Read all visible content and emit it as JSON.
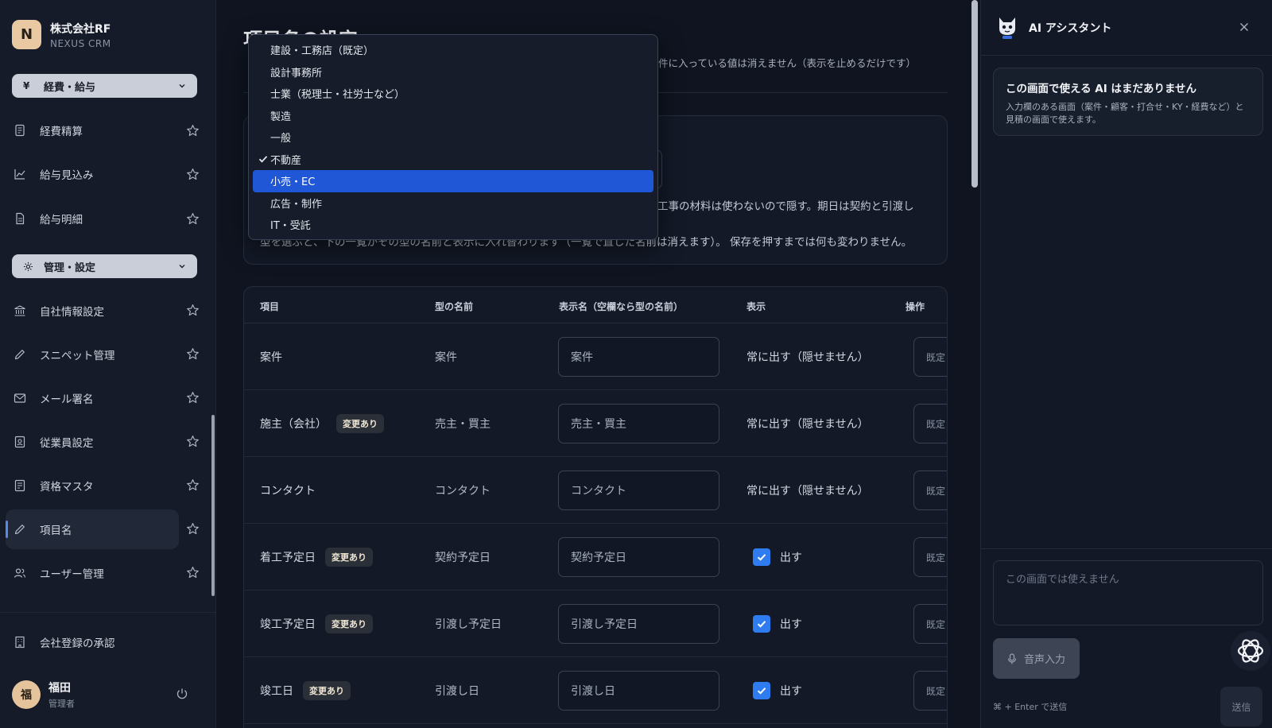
{
  "brand": {
    "logo_letter": "N",
    "name": "株式会社RF",
    "subtitle": "NEXUS CRM"
  },
  "sidebar": {
    "group_finance": {
      "icon": "yen-icon",
      "label": "経費・給与"
    },
    "finance_items": [
      {
        "icon": "receipt-icon",
        "label": "経費精算"
      },
      {
        "icon": "chart-line-icon",
        "label": "給与見込み"
      },
      {
        "icon": "document-icon",
        "label": "給与明細"
      }
    ],
    "group_admin": {
      "icon": "gear-icon",
      "label": "管理・設定"
    },
    "admin_items": [
      {
        "icon": "bank-icon",
        "label": "自社情報設定"
      },
      {
        "icon": "pencil-icon",
        "label": "スニペット管理"
      },
      {
        "icon": "mail-icon",
        "label": "メール署名"
      },
      {
        "icon": "id-badge-icon",
        "label": "従業員設定"
      },
      {
        "icon": "certificate-icon",
        "label": "資格マスタ"
      },
      {
        "icon": "pencil-icon",
        "label": "項目名",
        "active": true
      },
      {
        "icon": "users-icon",
        "label": "ユーザー管理"
      }
    ],
    "approval": {
      "icon": "building-icon",
      "label": "会社登録の承認"
    },
    "user": {
      "avatar": "福",
      "name": "福田",
      "role": "管理者"
    }
  },
  "main": {
    "title": "項目名の設定",
    "description_visible_end": "件に入っている値は消えません（表示を止めるだけです）",
    "card": {
      "text_line1_visible": "工事の材料は使わないので隠す。期日は契約と引渡し",
      "text_line2_visible": "型を選ぶと、下の一覧がその型の名前と表示に入れ替わります（一覧で直した名前は消えます）。 保存を押すまでは何も変わりません。"
    },
    "table": {
      "headers": [
        "項目",
        "型の名前",
        "表示名（空欄なら型の名前）",
        "表示",
        "操作"
      ],
      "rows": [
        {
          "item": "案件",
          "badge": "",
          "type_name": "案件",
          "display_name": "案件",
          "visibility": "常に出す（隠せません）",
          "checked": false,
          "op": "既定"
        },
        {
          "item": "施主（会社）",
          "badge": "変更あり",
          "type_name": "売主・買主",
          "display_name": "売主・買主",
          "visibility": "常に出す（隠せません）",
          "checked": false,
          "op": "既定"
        },
        {
          "item": "コンタクト",
          "badge": "",
          "type_name": "コンタクト",
          "display_name": "コンタクト",
          "visibility": "常に出す（隠せません）",
          "checked": false,
          "op": "既定"
        },
        {
          "item": "着工予定日",
          "badge": "変更あり",
          "type_name": "契約予定日",
          "display_name": "契約予定日",
          "visibility": "出す",
          "checked": true,
          "op": "既定"
        },
        {
          "item": "竣工予定日",
          "badge": "変更あり",
          "type_name": "引渡し予定日",
          "display_name": "引渡し予定日",
          "visibility": "出す",
          "checked": true,
          "op": "既定"
        },
        {
          "item": "竣工日",
          "badge": "変更あり",
          "type_name": "引渡し日",
          "display_name": "引渡し日",
          "visibility": "出す",
          "checked": true,
          "op": "既定"
        }
      ]
    }
  },
  "dropdown": {
    "options": [
      "建設・工務店（既定）",
      "設計事務所",
      "士業（税理士・社労士など）",
      "製造",
      "一般",
      "不動産",
      "小売・EC",
      "広告・制作",
      "IT・受託"
    ],
    "selected": "不動産",
    "highlighted": "小売・EC"
  },
  "ai_panel": {
    "title": "AI アシスタント",
    "logo_icon": "cat-robot-icon",
    "notice_title": "この画面で使える AI はまだありません",
    "notice_body": "入力欄のある画面（案件・顧客・打合せ・KY・経費など）と見積の画面で使えます。",
    "textarea_placeholder": "この画面では使えません",
    "voice_button": "音声入力",
    "hint": "⌘ + Enter で送信",
    "send_button": "送信"
  },
  "colors": {
    "accent": "#2057d6",
    "checkbox": "#2f7cf0",
    "background": "#0f1420",
    "sidebar": "#151b28"
  }
}
